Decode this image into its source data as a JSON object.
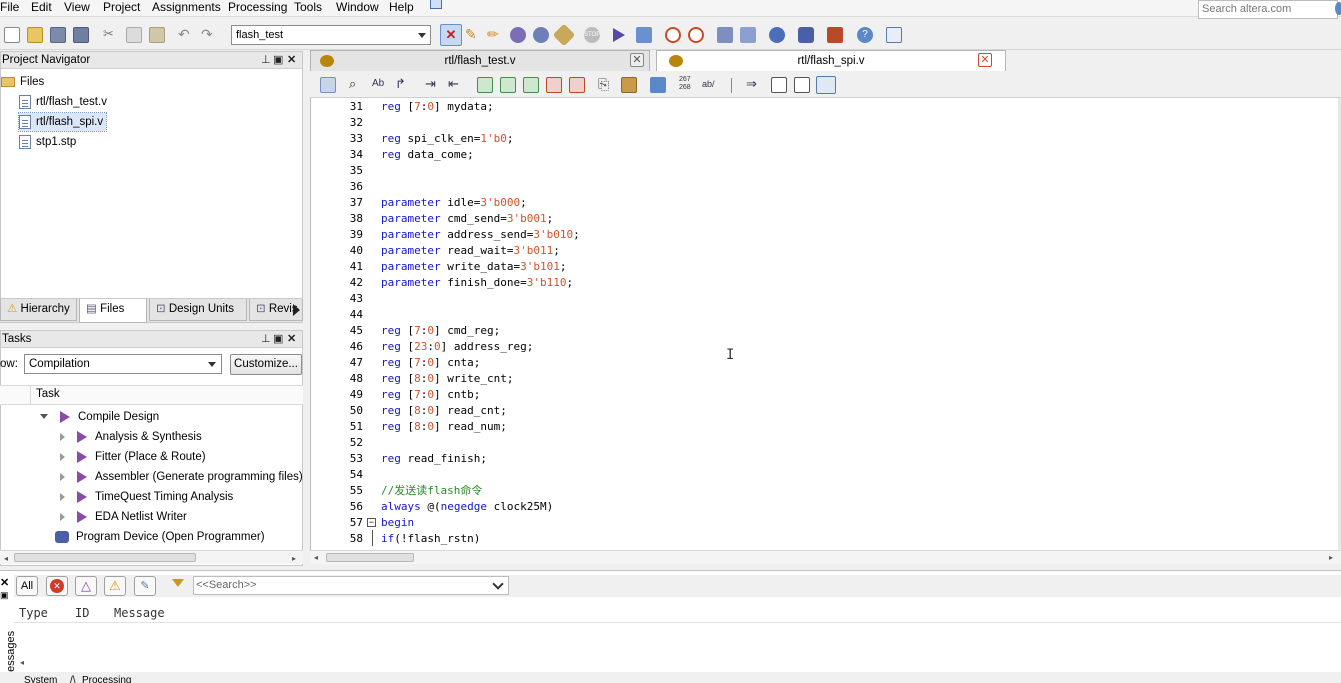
{
  "menu": {
    "items": [
      "File",
      "Edit",
      "View",
      "Project",
      "Assignments",
      "Processing",
      "Tools",
      "Window",
      "Help"
    ],
    "search_placeholder": "Search altera.com"
  },
  "toolbar": {
    "project_selector": "flash_test"
  },
  "navigator": {
    "title": "Project Navigator",
    "root": "Files",
    "files": [
      "rtl/flash_test.v",
      "rtl/flash_spi.v",
      "stp1.stp"
    ],
    "selected_index": 1,
    "tabs": [
      "Hierarchy",
      "Files",
      "Design Units",
      "Revis"
    ]
  },
  "tasks": {
    "title": "Tasks",
    "flow_label": "ow:",
    "flow_value": "Compilation",
    "customize_label": "Customize...",
    "column_header": "Task",
    "items": [
      {
        "label": "Compile Design",
        "level": 0,
        "expanded": true
      },
      {
        "label": "Analysis & Synthesis",
        "level": 1
      },
      {
        "label": "Fitter (Place & Route)",
        "level": 1
      },
      {
        "label": "Assembler (Generate programming files)",
        "level": 1
      },
      {
        "label": "TimeQuest Timing Analysis",
        "level": 1
      },
      {
        "label": "EDA Netlist Writer",
        "level": 1
      },
      {
        "label": "Program Device (Open Programmer)",
        "level": 0
      }
    ]
  },
  "editor": {
    "tabs": [
      {
        "label": "rtl/flash_test.v",
        "active": false
      },
      {
        "label": "rtl/flash_spi.v",
        "active": true
      }
    ],
    "lines": [
      {
        "n": "31",
        "t": [
          [
            "kw",
            "reg "
          ],
          [
            "",
            "["
          ],
          [
            "num",
            "7"
          ],
          [
            "",
            ":"
          ],
          [
            "num",
            "0"
          ],
          [
            "",
            "] mydata;"
          ]
        ]
      },
      {
        "n": "32",
        "t": []
      },
      {
        "n": "33",
        "t": [
          [
            "kw",
            "reg "
          ],
          [
            "",
            "spi_clk_en="
          ],
          [
            "num",
            "1'b0"
          ],
          [
            "",
            ";"
          ]
        ]
      },
      {
        "n": "34",
        "t": [
          [
            "kw",
            "reg "
          ],
          [
            "",
            "data_come;"
          ]
        ]
      },
      {
        "n": "35",
        "t": []
      },
      {
        "n": "36",
        "t": []
      },
      {
        "n": "37",
        "t": [
          [
            "kw",
            "parameter "
          ],
          [
            "",
            "idle="
          ],
          [
            "num",
            "3'b000"
          ],
          [
            "",
            ";"
          ]
        ]
      },
      {
        "n": "38",
        "t": [
          [
            "kw",
            "parameter "
          ],
          [
            "",
            "cmd_send="
          ],
          [
            "num",
            "3'b001"
          ],
          [
            "",
            ";"
          ]
        ]
      },
      {
        "n": "39",
        "t": [
          [
            "kw",
            "parameter "
          ],
          [
            "",
            "address_send="
          ],
          [
            "num",
            "3'b010"
          ],
          [
            "",
            ";"
          ]
        ]
      },
      {
        "n": "40",
        "t": [
          [
            "kw",
            "parameter "
          ],
          [
            "",
            "read_wait="
          ],
          [
            "num",
            "3'b011"
          ],
          [
            "",
            ";"
          ]
        ]
      },
      {
        "n": "41",
        "t": [
          [
            "kw",
            "parameter "
          ],
          [
            "",
            "write_data="
          ],
          [
            "num",
            "3'b101"
          ],
          [
            "",
            ";"
          ]
        ]
      },
      {
        "n": "42",
        "t": [
          [
            "kw",
            "parameter "
          ],
          [
            "",
            "finish_done="
          ],
          [
            "num",
            "3'b110"
          ],
          [
            "",
            ";"
          ]
        ]
      },
      {
        "n": "43",
        "t": []
      },
      {
        "n": "44",
        "t": []
      },
      {
        "n": "45",
        "t": [
          [
            "kw",
            "reg "
          ],
          [
            "",
            "["
          ],
          [
            "num",
            "7"
          ],
          [
            "",
            ":"
          ],
          [
            "num",
            "0"
          ],
          [
            "",
            "] cmd_reg;"
          ]
        ]
      },
      {
        "n": "46",
        "t": [
          [
            "kw",
            "reg "
          ],
          [
            "",
            "["
          ],
          [
            "num",
            "23"
          ],
          [
            "",
            ":"
          ],
          [
            "num",
            "0"
          ],
          [
            "",
            "] address_reg;"
          ]
        ]
      },
      {
        "n": "47",
        "t": [
          [
            "kw",
            "reg "
          ],
          [
            "",
            "["
          ],
          [
            "num",
            "7"
          ],
          [
            "",
            ":"
          ],
          [
            "num",
            "0"
          ],
          [
            "",
            "] cnta;"
          ]
        ]
      },
      {
        "n": "48",
        "t": [
          [
            "kw",
            "reg "
          ],
          [
            "",
            "["
          ],
          [
            "num",
            "8"
          ],
          [
            "",
            ":"
          ],
          [
            "num",
            "0"
          ],
          [
            "",
            "] write_cnt;"
          ]
        ]
      },
      {
        "n": "49",
        "t": [
          [
            "kw",
            "reg "
          ],
          [
            "",
            "["
          ],
          [
            "num",
            "7"
          ],
          [
            "",
            ":"
          ],
          [
            "num",
            "0"
          ],
          [
            "",
            "] cntb;"
          ]
        ]
      },
      {
        "n": "50",
        "t": [
          [
            "kw",
            "reg "
          ],
          [
            "",
            "["
          ],
          [
            "num",
            "8"
          ],
          [
            "",
            ":"
          ],
          [
            "num",
            "0"
          ],
          [
            "",
            "] read_cnt;"
          ]
        ]
      },
      {
        "n": "51",
        "t": [
          [
            "kw",
            "reg "
          ],
          [
            "",
            "["
          ],
          [
            "num",
            "8"
          ],
          [
            "",
            ":"
          ],
          [
            "num",
            "0"
          ],
          [
            "",
            "] read_num;"
          ]
        ]
      },
      {
        "n": "52",
        "t": []
      },
      {
        "n": "53",
        "t": [
          [
            "kw",
            "reg "
          ],
          [
            "",
            "read_finish;"
          ]
        ]
      },
      {
        "n": "54",
        "t": []
      },
      {
        "n": "55",
        "t": [
          [
            "cm",
            "//发送读flash命令"
          ]
        ]
      },
      {
        "n": "56",
        "t": [
          [
            "kw",
            "always "
          ],
          [
            "",
            "@("
          ],
          [
            "kw",
            "negedge "
          ],
          [
            "",
            "clock25M)"
          ]
        ]
      },
      {
        "n": "57",
        "t": [
          [
            "kw",
            "begin"
          ]
        ]
      },
      {
        "n": "58",
        "t": [
          [
            "kw",
            "if"
          ],
          [
            "",
            "(!flash_rstn)"
          ]
        ]
      }
    ]
  },
  "messages": {
    "filter_all": "All",
    "search_placeholder": "<<Search>>",
    "columns": [
      "Type",
      "ID",
      "Message"
    ],
    "side_label": "Messages",
    "bottom_tabs": [
      "System",
      "Processing"
    ]
  }
}
